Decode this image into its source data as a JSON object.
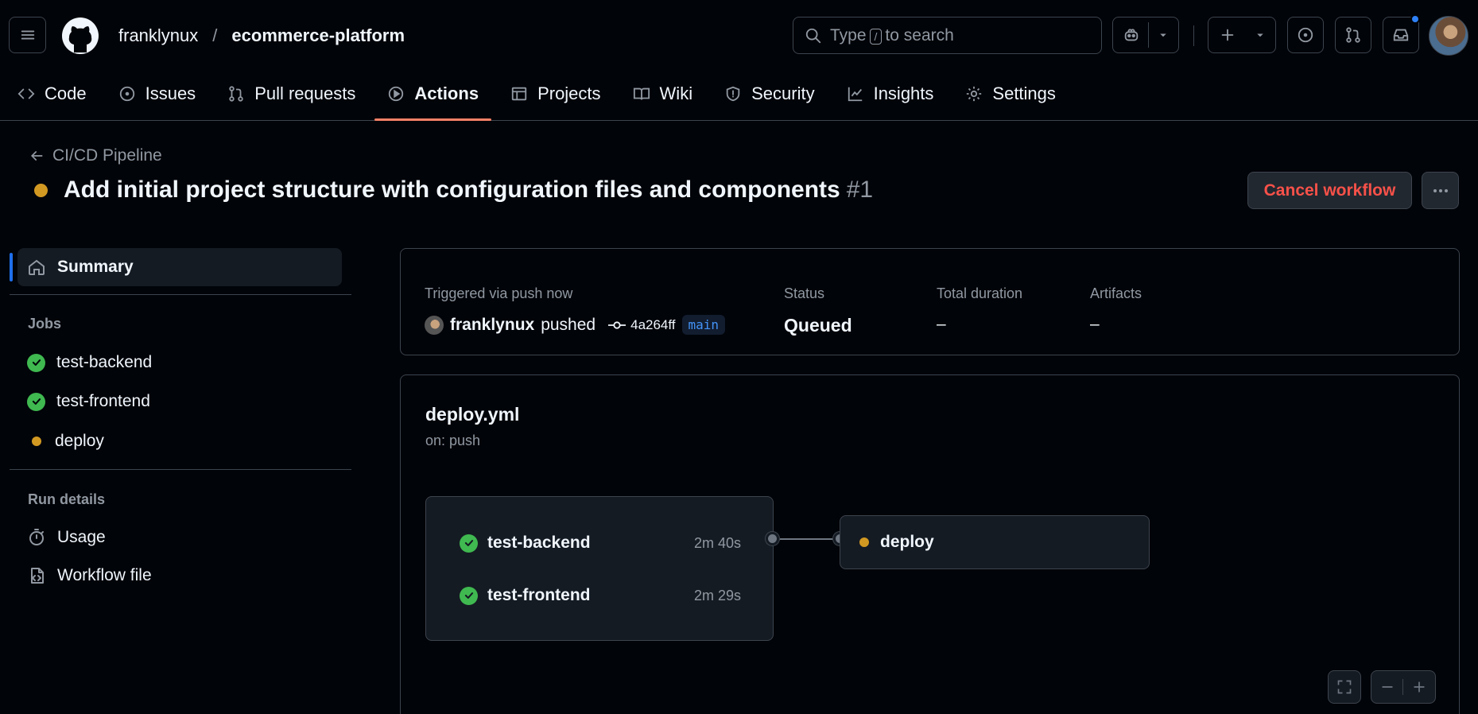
{
  "repo": {
    "owner": "franklynux",
    "separator": "/",
    "name": "ecommerce-platform"
  },
  "search": {
    "prefix": "Type",
    "key": "/",
    "suffix": "to search"
  },
  "tabs": [
    {
      "label": "Code",
      "icon": "code-icon"
    },
    {
      "label": "Issues",
      "icon": "issue-icon"
    },
    {
      "label": "Pull requests",
      "icon": "pull-request-icon"
    },
    {
      "label": "Actions",
      "icon": "play-icon",
      "active": true
    },
    {
      "label": "Projects",
      "icon": "table-icon"
    },
    {
      "label": "Wiki",
      "icon": "book-icon"
    },
    {
      "label": "Security",
      "icon": "shield-icon"
    },
    {
      "label": "Insights",
      "icon": "graph-icon"
    },
    {
      "label": "Settings",
      "icon": "gear-icon"
    }
  ],
  "page": {
    "back_label": "CI/CD Pipeline",
    "title": "Add initial project structure with configuration files and components",
    "run_number": "#1",
    "cancel_label": "Cancel workflow"
  },
  "sidebar": {
    "summary_label": "Summary",
    "jobs_heading": "Jobs",
    "jobs": [
      {
        "name": "test-backend",
        "status": "success"
      },
      {
        "name": "test-frontend",
        "status": "success"
      },
      {
        "name": "deploy",
        "status": "queued"
      }
    ],
    "run_details_heading": "Run details",
    "run_details": [
      {
        "label": "Usage",
        "icon": "stopwatch-icon"
      },
      {
        "label": "Workflow file",
        "icon": "file-code-icon"
      }
    ]
  },
  "summary": {
    "trigger_label": "Triggered via push now",
    "actor": "franklynux",
    "action": "pushed",
    "commit": "4a264ff",
    "branch": "main",
    "status_label": "Status",
    "status_value": "Queued",
    "duration_label": "Total duration",
    "duration_value": "–",
    "artifacts_label": "Artifacts",
    "artifacts_value": "–"
  },
  "workflow": {
    "file": "deploy.yml",
    "trigger": "on: push",
    "jobs": [
      {
        "name": "test-backend",
        "duration": "2m 40s"
      },
      {
        "name": "test-frontend",
        "duration": "2m 29s"
      }
    ],
    "downstream": "deploy"
  },
  "colors": {
    "accent": "#f78166",
    "success": "#3fb950",
    "queued": "#d29922",
    "danger": "#f85149",
    "link": "#4493f8"
  }
}
